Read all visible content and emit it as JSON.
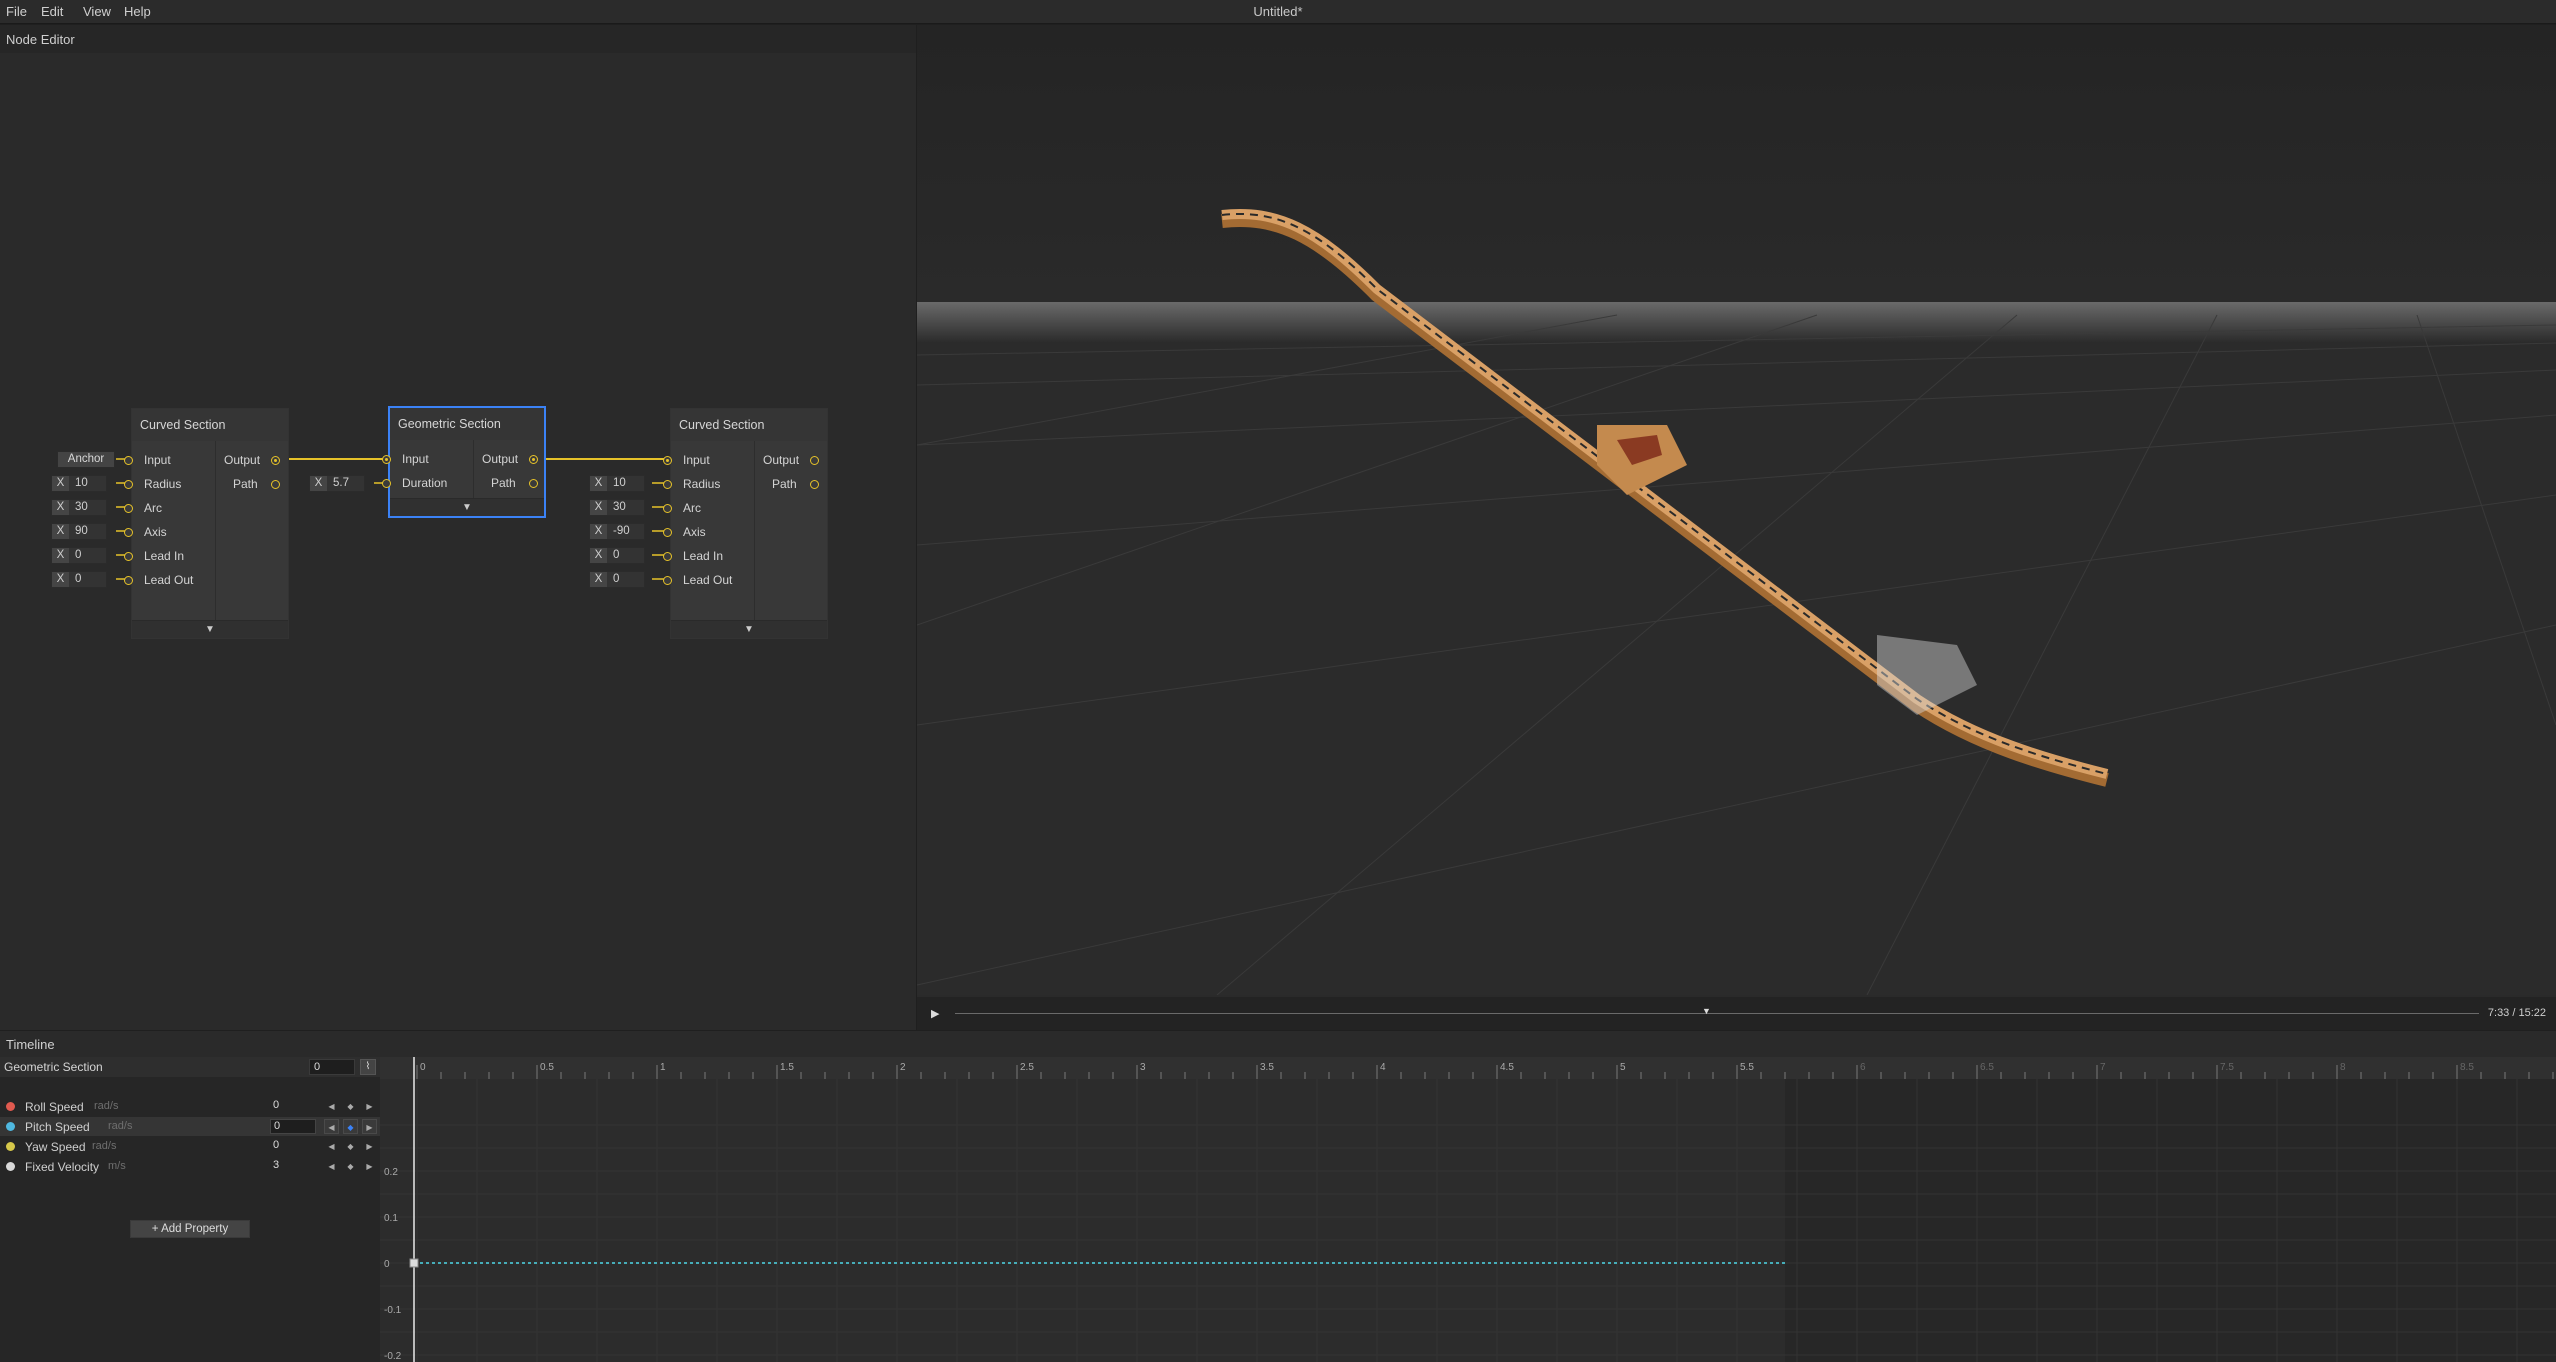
{
  "menu": {
    "file": "File",
    "edit": "Edit",
    "view": "View",
    "help": "Help"
  },
  "window_title": "Untitled*",
  "node_editor": {
    "title": "Node Editor",
    "nodes": {
      "curved1": {
        "title": "Curved Section",
        "inputs": [
          "Input",
          "Radius",
          "Arc",
          "Axis",
          "Lead In",
          "Lead Out"
        ],
        "outputs": [
          "Output",
          "Path"
        ],
        "anchor_label": "Anchor",
        "axis_label": "X",
        "values": [
          "10",
          "30",
          "90",
          "0",
          "0"
        ]
      },
      "geometric": {
        "title": "Geometric Section",
        "inputs": [
          "Input",
          "Duration"
        ],
        "outputs": [
          "Output",
          "Path"
        ],
        "axis_label": "X",
        "values": [
          "5.7"
        ]
      },
      "curved2": {
        "title": "Curved Section",
        "inputs": [
          "Input",
          "Radius",
          "Arc",
          "Axis",
          "Lead In",
          "Lead Out"
        ],
        "outputs": [
          "Output",
          "Path"
        ],
        "axis_label": "X",
        "values": [
          "10",
          "30",
          "-90",
          "0",
          "0"
        ]
      }
    },
    "collapse_glyph": "▼",
    "wire_color": "#e6c229"
  },
  "viewport": {
    "play_icon": "▶",
    "scrub_icon": "▼",
    "time": "7:33 / 15:22",
    "track_color": "#d9a066"
  },
  "timeline": {
    "title": "Timeline",
    "section": {
      "name": "Geometric Section",
      "value": "0",
      "curve_icon": "⌇"
    },
    "properties": [
      {
        "name": "Roll Speed",
        "unit": "rad/s",
        "value": "0",
        "color": "#e05a4f",
        "selected": false
      },
      {
        "name": "Pitch Speed",
        "unit": "rad/s",
        "value": "0",
        "color": "#4fb8e0",
        "selected": true
      },
      {
        "name": "Yaw Speed",
        "unit": "rad/s",
        "value": "0",
        "color": "#d6c84a",
        "selected": false
      },
      {
        "name": "Fixed Velocity",
        "unit": "m/s",
        "value": "3",
        "color": "#d8d8d8",
        "selected": false
      }
    ],
    "kf_prev": "◀",
    "kf_add": "◆",
    "kf_next": "▶",
    "add_property": "+ Add Property",
    "ruler_labels": [
      "0",
      "0.5",
      "1",
      "1.5",
      "2",
      "2.5",
      "3",
      "3.5",
      "4",
      "4.5",
      "5",
      "5.5",
      "6",
      "6.5",
      "7",
      "7.5",
      "8",
      "8.5"
    ],
    "y_labels": [
      "0.2",
      "0.1",
      "0",
      "-0.1",
      "-0.2"
    ],
    "section_duration": 5.7,
    "curve_color": "#4fd8e8"
  }
}
